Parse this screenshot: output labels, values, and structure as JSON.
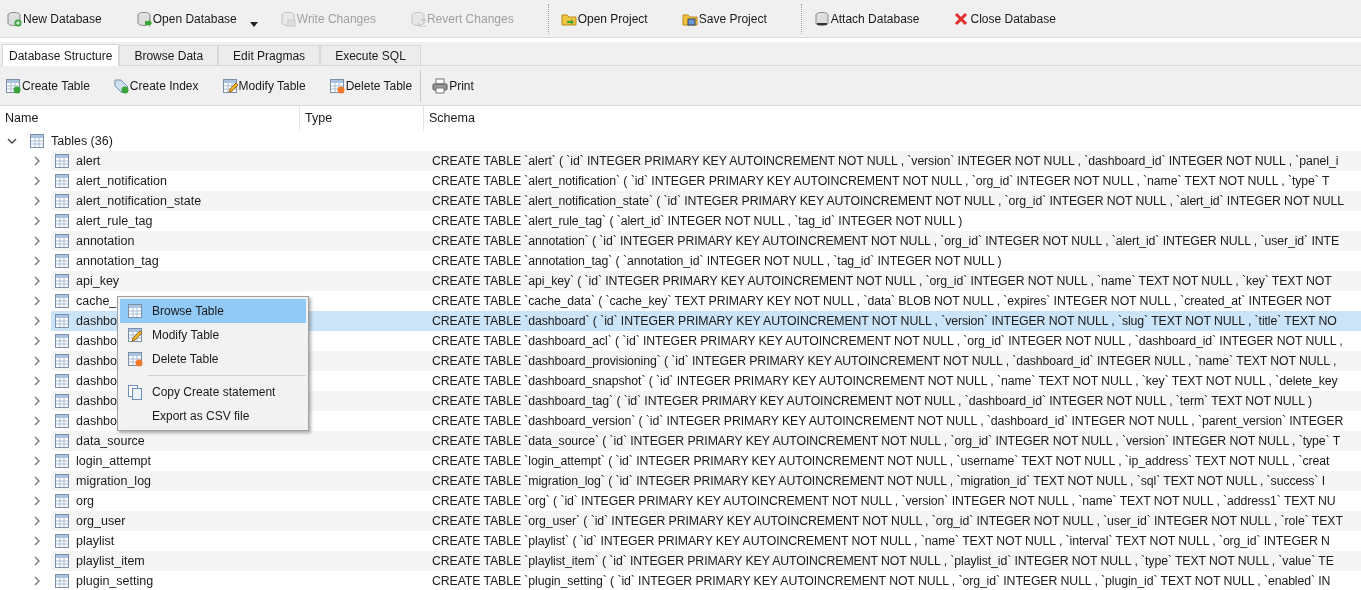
{
  "toolbar": {
    "groups": [
      [
        {
          "label": "New Database",
          "disabled": false,
          "has_menu": false
        },
        {
          "label": "Open Database",
          "disabled": false,
          "has_menu": true
        },
        {
          "label": "Write Changes",
          "disabled": true,
          "has_menu": false
        },
        {
          "label": "Revert Changes",
          "disabled": true,
          "has_menu": false
        }
      ],
      [
        {
          "label": "Open Project",
          "disabled": false,
          "has_menu": false
        },
        {
          "label": "Save Project",
          "disabled": false,
          "has_menu": false
        }
      ],
      [
        {
          "label": "Attach Database",
          "disabled": false,
          "has_menu": false
        },
        {
          "label": "Close Database",
          "disabled": false,
          "has_menu": false
        }
      ]
    ]
  },
  "tabs": [
    {
      "label": "Database Structure",
      "selected": true
    },
    {
      "label": "Browse Data",
      "selected": false
    },
    {
      "label": "Edit Pragmas",
      "selected": false
    },
    {
      "label": "Execute SQL",
      "selected": false
    }
  ],
  "structure_toolbar": {
    "groups": [
      [
        {
          "label": "Create Table"
        },
        {
          "label": "Create Index"
        },
        {
          "label": "Modify Table"
        },
        {
          "label": "Delete Table"
        }
      ],
      [
        {
          "label": "Print"
        }
      ]
    ]
  },
  "tree": {
    "columns": [
      "Name",
      "Type",
      "Schema"
    ],
    "root": {
      "label": "Tables (36)",
      "expanded": true,
      "children": [
        {
          "label": "alert",
          "expanded": false,
          "selected": false,
          "schema": "CREATE TABLE `alert` ( `id` INTEGER PRIMARY KEY AUTOINCREMENT NOT NULL , `version` INTEGER NOT NULL , `dashboard_id` INTEGER NOT NULL , `panel_i"
        },
        {
          "label": "alert_notification",
          "expanded": false,
          "selected": false,
          "schema": "CREATE TABLE `alert_notification` ( `id` INTEGER PRIMARY KEY AUTOINCREMENT NOT NULL , `org_id` INTEGER NOT NULL , `name` TEXT NOT NULL , `type` T"
        },
        {
          "label": "alert_notification_state",
          "expanded": false,
          "selected": false,
          "schema": "CREATE TABLE `alert_notification_state` ( `id` INTEGER PRIMARY KEY AUTOINCREMENT NOT NULL , `org_id` INTEGER NOT NULL , `alert_id` INTEGER NOT NULL"
        },
        {
          "label": "alert_rule_tag",
          "expanded": false,
          "selected": false,
          "schema": "CREATE TABLE `alert_rule_tag` ( `alert_id` INTEGER NOT NULL , `tag_id` INTEGER NOT NULL )"
        },
        {
          "label": "annotation",
          "expanded": false,
          "selected": false,
          "schema": "CREATE TABLE `annotation` ( `id` INTEGER PRIMARY KEY AUTOINCREMENT NOT NULL , `org_id` INTEGER NOT NULL , `alert_id` INTEGER NULL , `user_id` INTE"
        },
        {
          "label": "annotation_tag",
          "expanded": false,
          "selected": false,
          "schema": "CREATE TABLE `annotation_tag` ( `annotation_id` INTEGER NOT NULL , `tag_id` INTEGER NOT NULL )"
        },
        {
          "label": "api_key",
          "expanded": false,
          "selected": false,
          "schema": "CREATE TABLE `api_key` ( `id` INTEGER PRIMARY KEY AUTOINCREMENT NOT NULL , `org_id` INTEGER NOT NULL , `name` TEXT NOT NULL , `key` TEXT NOT"
        },
        {
          "label": "cache_",
          "expanded": false,
          "selected": false,
          "schema": "CREATE TABLE `cache_data` ( `cache_key` TEXT PRIMARY KEY NOT NULL , `data` BLOB NOT NULL , `expires` INTEGER NOT NULL , `created_at` INTEGER NOT"
        },
        {
          "label": "dashbo",
          "expanded": false,
          "selected": true,
          "schema": "CREATE TABLE `dashboard` ( `id` INTEGER PRIMARY KEY AUTOINCREMENT NOT NULL , `version` INTEGER NOT NULL , `slug` TEXT NOT NULL , `title` TEXT NO"
        },
        {
          "label": "dashbo",
          "expanded": false,
          "selected": false,
          "schema": "CREATE TABLE `dashboard_acl` ( `id` INTEGER PRIMARY KEY AUTOINCREMENT NOT NULL , `org_id` INTEGER NOT NULL , `dashboard_id` INTEGER NOT NULL ,"
        },
        {
          "label": "dashbo",
          "expanded": false,
          "selected": false,
          "schema": "CREATE TABLE `dashboard_provisioning` ( `id` INTEGER PRIMARY KEY AUTOINCREMENT NOT NULL , `dashboard_id` INTEGER NULL , `name` TEXT NOT NULL ,"
        },
        {
          "label": "dashbo",
          "expanded": false,
          "selected": false,
          "schema": "CREATE TABLE `dashboard_snapshot` ( `id` INTEGER PRIMARY KEY AUTOINCREMENT NOT NULL , `name` TEXT NOT NULL , `key` TEXT NOT NULL , `delete_key"
        },
        {
          "label": "dashbo",
          "expanded": false,
          "selected": false,
          "schema": "CREATE TABLE `dashboard_tag` ( `id` INTEGER PRIMARY KEY AUTOINCREMENT NOT NULL , `dashboard_id` INTEGER NOT NULL , `term` TEXT NOT NULL )"
        },
        {
          "label": "dashbo",
          "expanded": false,
          "selected": false,
          "schema": "CREATE TABLE `dashboard_version` ( `id` INTEGER PRIMARY KEY AUTOINCREMENT NOT NULL , `dashboard_id` INTEGER NOT NULL , `parent_version` INTEGER"
        },
        {
          "label": "data_source",
          "expanded": false,
          "selected": false,
          "schema": "CREATE TABLE `data_source` ( `id` INTEGER PRIMARY KEY AUTOINCREMENT NOT NULL , `org_id` INTEGER NOT NULL , `version` INTEGER NOT NULL , `type` T"
        },
        {
          "label": "login_attempt",
          "expanded": false,
          "selected": false,
          "schema": "CREATE TABLE `login_attempt` ( `id` INTEGER PRIMARY KEY AUTOINCREMENT NOT NULL , `username` TEXT NOT NULL , `ip_address` TEXT NOT NULL , `creat"
        },
        {
          "label": "migration_log",
          "expanded": false,
          "selected": false,
          "schema": "CREATE TABLE `migration_log` ( `id` INTEGER PRIMARY KEY AUTOINCREMENT NOT NULL , `migration_id` TEXT NOT NULL , `sql` TEXT NOT NULL , `success` I"
        },
        {
          "label": "org",
          "expanded": false,
          "selected": false,
          "schema": "CREATE TABLE `org` ( `id` INTEGER PRIMARY KEY AUTOINCREMENT NOT NULL , `version` INTEGER NOT NULL , `name` TEXT NOT NULL , `address1` TEXT NU"
        },
        {
          "label": "org_user",
          "expanded": false,
          "selected": false,
          "schema": "CREATE TABLE `org_user` ( `id` INTEGER PRIMARY KEY AUTOINCREMENT NOT NULL , `org_id` INTEGER NOT NULL , `user_id` INTEGER NOT NULL , `role` TEXT"
        },
        {
          "label": "playlist",
          "expanded": false,
          "selected": false,
          "schema": "CREATE TABLE `playlist` ( `id` INTEGER PRIMARY KEY AUTOINCREMENT NOT NULL , `name` TEXT NOT NULL , `interval` TEXT NOT NULL , `org_id` INTEGER N"
        },
        {
          "label": "playlist_item",
          "expanded": false,
          "selected": false,
          "schema": "CREATE TABLE `playlist_item` ( `id` INTEGER PRIMARY KEY AUTOINCREMENT NOT NULL , `playlist_id` INTEGER NOT NULL , `type` TEXT NOT NULL , `value` TE"
        },
        {
          "label": "plugin_setting",
          "expanded": false,
          "selected": false,
          "schema": "CREATE TABLE `plugin_setting` ( `id` INTEGER PRIMARY KEY AUTOINCREMENT NOT NULL , `org_id` INTEGER NULL , `plugin_id` TEXT NOT NULL , `enabled` IN"
        }
      ]
    }
  },
  "context_menu": {
    "items": [
      {
        "kind": "item",
        "label": "Browse Table",
        "selected": true
      },
      {
        "kind": "item",
        "label": "Modify Table",
        "selected": false
      },
      {
        "kind": "item",
        "label": "Delete Table",
        "selected": false
      },
      {
        "kind": "separator"
      },
      {
        "kind": "item",
        "label": "Copy Create statement",
        "selected": false
      },
      {
        "kind": "item",
        "label": "Export as CSV file",
        "selected": false
      }
    ]
  }
}
